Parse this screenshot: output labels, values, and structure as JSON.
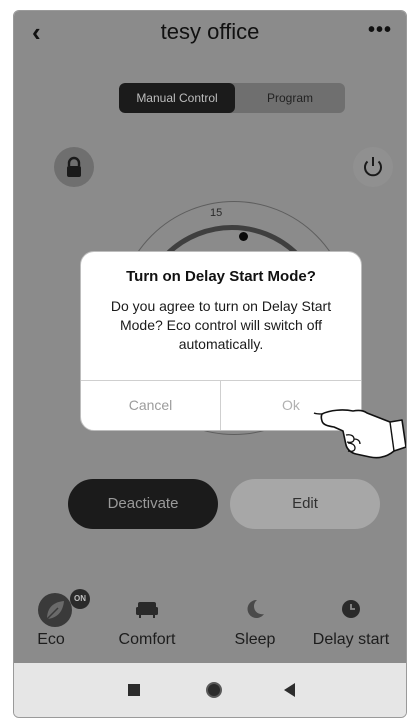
{
  "header": {
    "back_icon": "chevron-left-icon",
    "title": "tesy office",
    "more_icon": "more-horizontal-icon"
  },
  "tabs": {
    "manual": "Manual Control",
    "program": "Program"
  },
  "controls": {
    "lock_icon": "lock-icon",
    "power_icon": "power-icon"
  },
  "dial": {
    "tick_label": "15"
  },
  "actions": {
    "deactivate": "Deactivate",
    "edit": "Edit"
  },
  "modes": [
    {
      "label": "Eco",
      "badge": "ON",
      "icon": "leaf-icon"
    },
    {
      "label": "Comfort",
      "icon": "sofa-icon"
    },
    {
      "label": "Sleep",
      "icon": "moon-icon"
    },
    {
      "label": "Delay start",
      "icon": "clock-icon"
    }
  ],
  "dialog": {
    "title": "Turn on Delay Start Mode?",
    "message": "Do you agree to turn on Delay Start Mode? Eco control will switch off automatically.",
    "cancel": "Cancel",
    "ok": "Ok"
  },
  "colors": {
    "overlay": "#8b8b8b",
    "dark_button": "#1b1b1b",
    "dialog_bg": "#ffffff"
  }
}
